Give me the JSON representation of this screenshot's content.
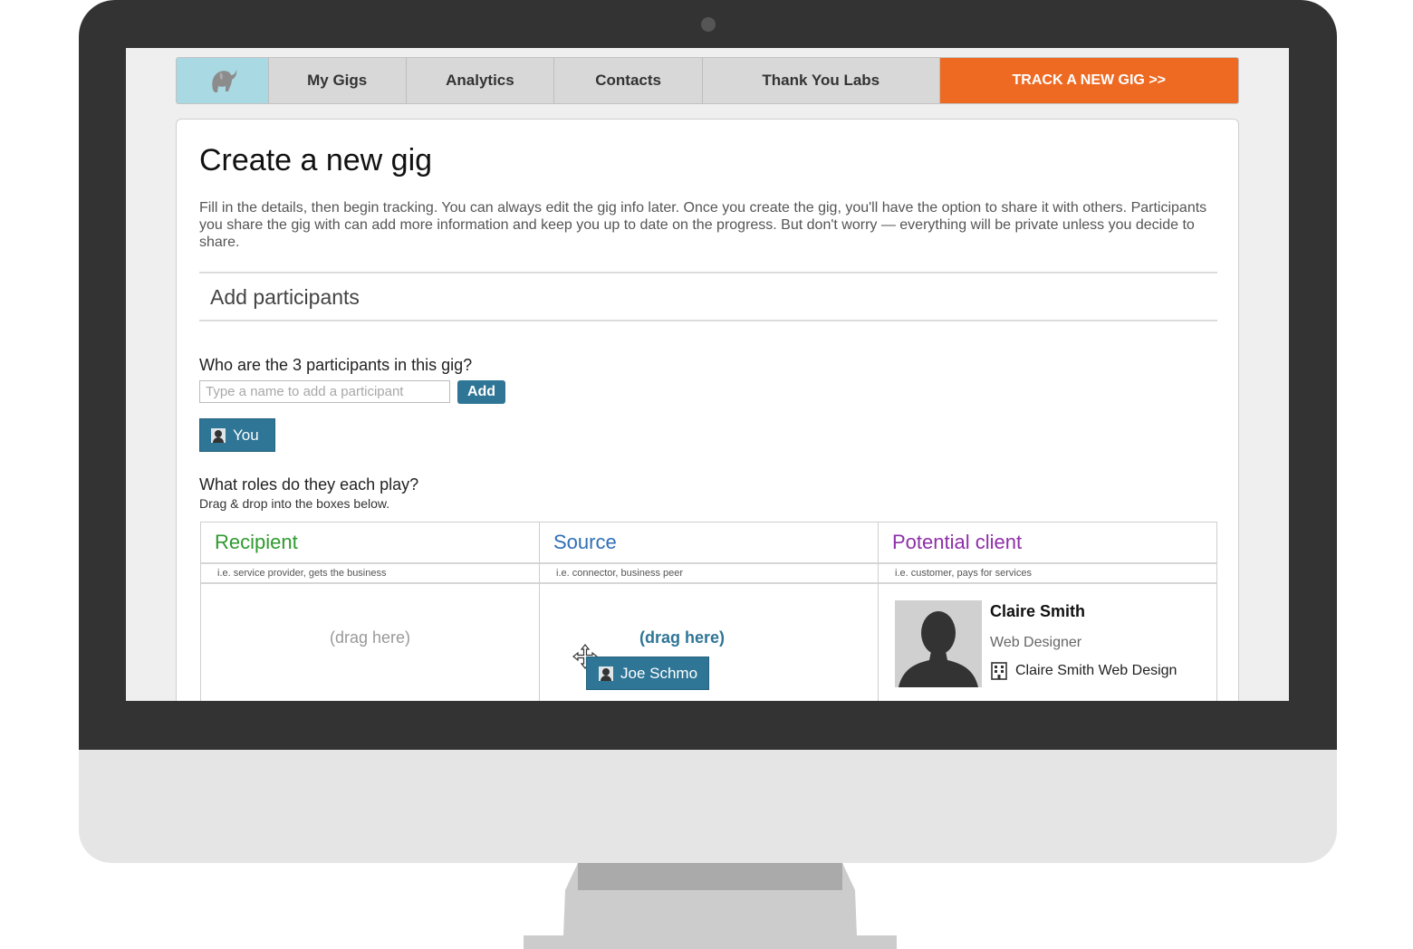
{
  "nav": {
    "logo_icon": "elephant-icon",
    "tabs": [
      {
        "label": "My Gigs"
      },
      {
        "label": "Analytics"
      },
      {
        "label": "Contacts"
      },
      {
        "label": "Thank You Labs"
      }
    ],
    "cta_label": "TRACK A NEW GIG >>",
    "colors": {
      "logo_bg": "#a9d9e2",
      "tab_bg": "#d8d8d8",
      "cta_bg": "#ee6a23"
    }
  },
  "page": {
    "title": "Create a new gig",
    "intro": "Fill in the details, then begin tracking. You can always edit the gig info later. Once you create the gig, you'll have the option to share it with others. Participants you share the gig with can add more information and keep you up to date on the progress. But don't worry — everything will be private unless you decide to share.",
    "section_title": "Add participants"
  },
  "participants": {
    "question": "Who are the 3 participants in this gig?",
    "input_placeholder": "Type a name to add a participant",
    "input_value": "",
    "add_label": "Add",
    "chips": [
      {
        "label": "You"
      }
    ]
  },
  "roles": {
    "question": "What roles do they each play?",
    "hint": "Drag & drop into the boxes below.",
    "columns": [
      {
        "title": "Recipient",
        "subtitle": "i.e. service provider, gets the business",
        "drop_label": "(drag here)",
        "color": "#2e9a2e"
      },
      {
        "title": "Source",
        "subtitle": "i.e. connector, business peer",
        "drop_label": "(drag here)",
        "color": "#2f6fb5",
        "dragging_chip": "Joe Schmo"
      },
      {
        "title": "Potential client",
        "subtitle": "i.e. customer, pays for services",
        "color": "#8e2fa8",
        "assigned": {
          "name": "Claire Smith",
          "title": "Web Designer",
          "company": "Claire Smith Web Design"
        }
      }
    ]
  },
  "accent_color": "#2e7596"
}
